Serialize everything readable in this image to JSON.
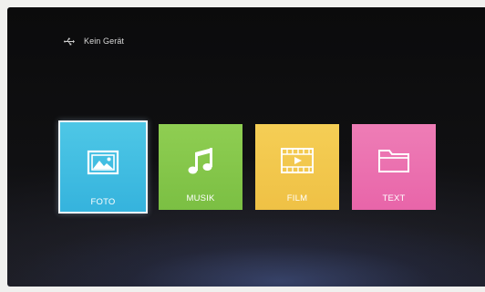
{
  "status": {
    "usb_icon": "usb-icon",
    "device_text": "Kein Gerät"
  },
  "tiles": [
    {
      "label": "FOTO",
      "icon": "photo-icon",
      "color": "#45c0e3",
      "selected": true
    },
    {
      "label": "MUSIK",
      "icon": "music-note-icon",
      "color": "#86c84b",
      "selected": false
    },
    {
      "label": "FILM",
      "icon": "film-icon",
      "color": "#f3c94f",
      "selected": false
    },
    {
      "label": "TEXT",
      "icon": "folder-icon",
      "color": "#ec72b0",
      "selected": false
    }
  ]
}
